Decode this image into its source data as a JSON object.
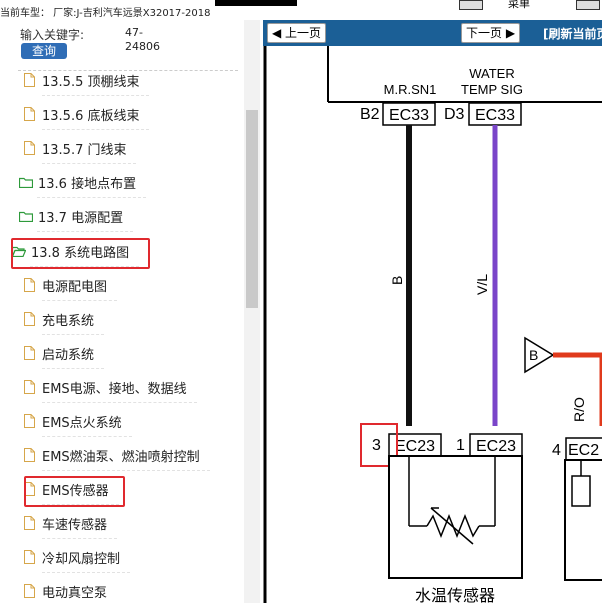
{
  "topbar": {
    "car_info": "当前车型：  厂家:J-吉利汽车远景X32017-2018",
    "menu_label": "菜单"
  },
  "search": {
    "label": "输入关键字:",
    "button": "查询",
    "code_line1": "47-",
    "code_line2": "24806"
  },
  "tree": {
    "items": [
      {
        "label": "13.5.5 顶棚线束",
        "icon": "file-icon"
      },
      {
        "label": "13.5.6 底板线束",
        "icon": "file-icon"
      },
      {
        "label": "13.5.7 门线束",
        "icon": "file-icon"
      },
      {
        "label": "13.6 接地点布置",
        "icon": "folder-icon"
      },
      {
        "label": "13.7 电源配置",
        "icon": "folder-icon"
      },
      {
        "label": "13.8 系统电路图",
        "icon": "folder-open-icon"
      },
      {
        "label": "电源配电图",
        "icon": "file-icon"
      },
      {
        "label": "充电系统",
        "icon": "file-icon"
      },
      {
        "label": "启动系统",
        "icon": "file-icon"
      },
      {
        "label": "EMS电源、接地、数据线",
        "icon": "file-icon"
      },
      {
        "label": "EMS点火系统",
        "icon": "file-icon"
      },
      {
        "label": "EMS燃油泵、燃油喷射控制",
        "icon": "file-icon"
      },
      {
        "label": "EMS传感器",
        "icon": "file-icon"
      },
      {
        "label": "车速传感器",
        "icon": "file-icon"
      },
      {
        "label": "冷却风扇控制",
        "icon": "file-icon"
      },
      {
        "label": "电动真空泵",
        "icon": "file-icon"
      }
    ]
  },
  "nav": {
    "prev": "上一页",
    "next": "下一页",
    "refresh": "[刷新当前页]"
  },
  "diagram": {
    "water_label_1": "WATER",
    "water_label_2": "TEMP SIG",
    "mrsn1_label": "M.R.SN1",
    "pin_b2": "B2",
    "conn_ec33_a": "EC33",
    "pin_d3": "D3",
    "conn_ec33_b": "EC33",
    "wire_b": "B",
    "wire_vl": "V/L",
    "pin_3": "3",
    "conn_ec23_a": "EC23",
    "pin_1": "1",
    "conn_ec23_b": "EC23",
    "pin_4": "4",
    "conn_ec2": "EC2",
    "wire_ro": "R/O",
    "triangle_b": "B",
    "sensor_label": "水温传感器",
    "colors": {
      "black_wire": "#111111",
      "violet_wire": "#7a45c9",
      "red_wire": "#e03a1c",
      "highlight": "#e0292e"
    }
  }
}
